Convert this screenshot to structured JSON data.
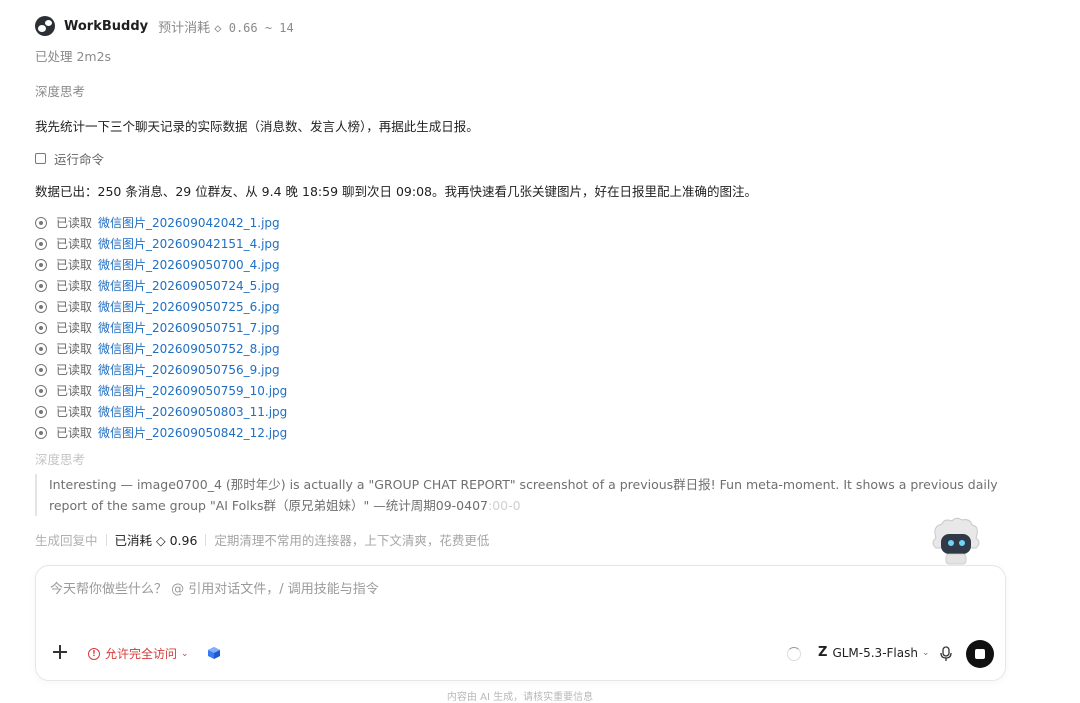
{
  "header": {
    "brand": "WorkBuddy",
    "estimate_label": "预计消耗",
    "estimate_value": "◇ 0.66 ~ 14"
  },
  "processed": "已处理 2m2s",
  "thinking_1": "深度思考",
  "message_1": "我先统计一下三个聊天记录的实际数据（消息数、发言人榜），再据此生成日报。",
  "run_command": "运行命令",
  "message_2": "数据已出：250 条消息、29 位群友、从 9.4 晚 18:59 聊到次日 09:08。我再快速看几张关键图片，好在日报里配上准确的图注。",
  "read_label": "已读取",
  "files": [
    "微信图片_202609042042_1.jpg",
    "微信图片_202609042151_4.jpg",
    "微信图片_202609050700_4.jpg",
    "微信图片_202609050724_5.jpg",
    "微信图片_202609050725_6.jpg",
    "微信图片_202609050751_7.jpg",
    "微信图片_202609050752_8.jpg",
    "微信图片_202609050756_9.jpg",
    "微信图片_202609050759_10.jpg",
    "微信图片_202609050803_11.jpg",
    "微信图片_202609050842_12.jpg"
  ],
  "thinking_2": "深度思考",
  "quote_text": "Interesting — image0700_4 (那时年少) is actually a \"GROUP CHAT REPORT\" screenshot of a previous群日报! Fun meta-moment. It shows a previous daily report of the same group \"AI Folks群（原兄弟姐妹）\" —统计周期09-0407",
  "quote_fade": ":00-0",
  "status": {
    "generating": "生成回复中",
    "cost": "已消耗 ◇ 0.96",
    "tip": "定期清理不常用的连接器，上下文清爽，花费更低"
  },
  "input": {
    "placeholder": "今天帮你做些什么？ @ 引用对话文件，/ 调用技能与指令"
  },
  "toolbar": {
    "access_label": "允许完全访问",
    "model_label": "GLM-5.3-Flash"
  },
  "footer": "内容由 AI 生成，请核实重要信息",
  "colors": {
    "link": "#1f6fc4",
    "warning": "#d63b3b"
  }
}
